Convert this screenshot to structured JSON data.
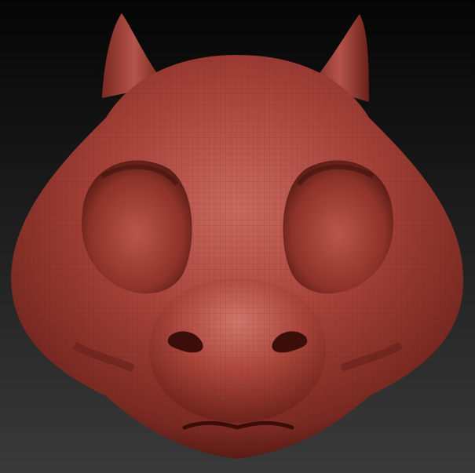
{
  "viewport": {
    "background_top": "#050505",
    "background_bottom": "#3a3a3a"
  },
  "model": {
    "subject": "sculpted-creature-head",
    "material_color": "#a8433a",
    "highlight_color": "#cf7a70",
    "shadow_color": "#4a1510",
    "wireframe": true,
    "features": [
      "horn-left",
      "horn-right",
      "head",
      "eye-socket-left",
      "eye-socket-right",
      "muzzle",
      "nostril-left",
      "nostril-right",
      "mouth"
    ]
  }
}
